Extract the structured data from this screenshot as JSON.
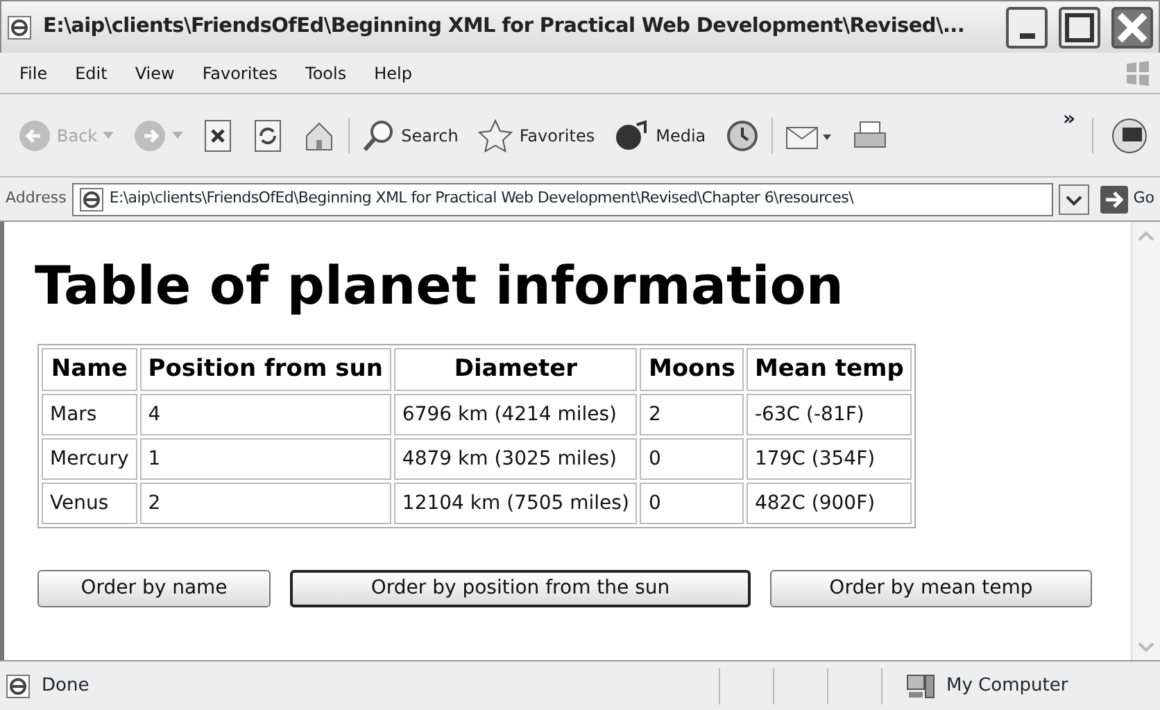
{
  "window": {
    "title": "E:\\aip\\clients\\FriendsOfEd\\Beginning XML for Practical Web Development\\Revised\\..."
  },
  "menu": [
    "File",
    "Edit",
    "View",
    "Favorites",
    "Tools",
    "Help"
  ],
  "toolbar": [
    {
      "kind": "back",
      "label": "Back",
      "disabled": true
    },
    {
      "kind": "forward",
      "disabled": true
    },
    {
      "kind": "stop"
    },
    {
      "kind": "refresh"
    },
    {
      "kind": "home"
    },
    {
      "kind": "search",
      "label": "Search"
    },
    {
      "kind": "favorites",
      "label": "Favorites"
    },
    {
      "kind": "media",
      "label": "Media"
    },
    {
      "kind": "history"
    },
    {
      "kind": "mail"
    },
    {
      "kind": "print"
    }
  ],
  "toolbar_more": "»",
  "address": {
    "label": "Address",
    "value": "E:\\aip\\clients\\FriendsOfEd\\Beginning XML for Practical Web Development\\Revised\\Chapter 6\\resources\\",
    "go": "Go"
  },
  "page": {
    "heading": "Table of planet information",
    "table": {
      "columns": [
        "Name",
        "Position from sun",
        "Diameter",
        "Moons",
        "Mean temp"
      ],
      "rows": [
        [
          "Mars",
          "4",
          "6796 km (4214 miles)",
          "2",
          "-63C (-81F)"
        ],
        [
          "Mercury",
          "1",
          "4879 km (3025 miles)",
          "0",
          "179C (354F)"
        ],
        [
          "Venus",
          "2",
          "12104 km (7505 miles)",
          "0",
          "482C (900F)"
        ]
      ]
    },
    "buttons": [
      {
        "label": "Order by name",
        "focused": false
      },
      {
        "label": "Order by position from the sun",
        "focused": true
      },
      {
        "label": "Order by mean temp",
        "focused": false
      }
    ]
  },
  "status_bar": {
    "text": "Done",
    "zone": "My Computer"
  }
}
